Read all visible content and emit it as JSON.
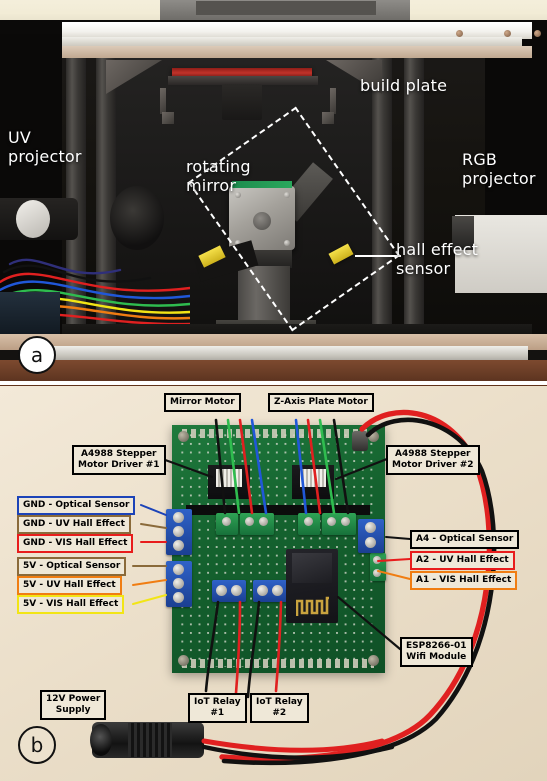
{
  "figure": {
    "panels": [
      {
        "id": "a",
        "badge": "a",
        "kind": "photograph",
        "caption_labels": [
          {
            "name": "uv-projector",
            "text": "UV\nprojector"
          },
          {
            "name": "rotating-mirror",
            "text": "rotating\nmirror"
          },
          {
            "name": "build-plate",
            "text": "build plate"
          },
          {
            "name": "rgb-projector",
            "text": "RGB\nprojector"
          },
          {
            "name": "hall-effect-sensor",
            "text": "hall effect\nsensor"
          }
        ]
      },
      {
        "id": "b",
        "badge": "b",
        "kind": "photograph",
        "callouts": [
          {
            "name": "mirror-motor",
            "text": "Mirror Motor",
            "border": "#000000"
          },
          {
            "name": "z-axis-plate-motor",
            "text": "Z-Axis Plate Motor",
            "border": "#000000"
          },
          {
            "name": "driver-1",
            "text": "A4988 Stepper\nMotor Driver #1",
            "border": "#000000"
          },
          {
            "name": "driver-2",
            "text": "A4988 Stepper\nMotor Driver #2",
            "border": "#000000"
          },
          {
            "name": "gnd-optical-sensor",
            "text": "GND - Optical Sensor",
            "border": "#1c43b8"
          },
          {
            "name": "gnd-uv-hall-effect",
            "text": "GND - UV Hall Effect",
            "border": "#8a6a3a"
          },
          {
            "name": "gnd-vis-hall-effect",
            "text": "GND - VIS Hall Effect",
            "border": "#e81c1c"
          },
          {
            "name": "5v-optical-sensor",
            "text": "5V - Optical Sensor",
            "border": "#8a6a3a"
          },
          {
            "name": "5v-uv-hall-effect",
            "text": "5V - UV Hall Effect",
            "border": "#f07d12"
          },
          {
            "name": "5v-vis-hall-effect",
            "text": "5V - VIS Hall Effect",
            "border": "#f2e516"
          },
          {
            "name": "a4-optical-sensor",
            "text": "A4 - Optical Sensor",
            "border": "#000000"
          },
          {
            "name": "a2-uv-hall-effect",
            "text": "A2 - UV Hall Effect",
            "border": "#e81c1c"
          },
          {
            "name": "a1-vis-hall-effect",
            "text": "A1 - VIS Hall Effect",
            "border": "#f07d12"
          },
          {
            "name": "esp8266-wifi-module",
            "text": "ESP8266-01\nWifi Module",
            "border": "#000000"
          },
          {
            "name": "iot-relay-1",
            "text": "IoT Relay\n#1",
            "border": "#000000"
          },
          {
            "name": "iot-relay-2",
            "text": "IoT Relay\n#2",
            "border": "#000000"
          },
          {
            "name": "12v-power-supply",
            "text": "12V Power\nSupply",
            "border": "#000000"
          }
        ]
      }
    ],
    "colors": {
      "wire_red": "#e02020",
      "wire_black": "#111111",
      "wire_green": "#2fbc4f",
      "wire_blue": "#2057d8",
      "wire_orange": "#f07d12",
      "wire_yellow": "#f2e516",
      "wire_brown": "#8a6a3a",
      "pcb_green": "#17713a",
      "terminal_blue": "#2f62c8",
      "terminal_green": "#2fa355",
      "panel_b_background": "#ece0cb",
      "label_fill": "#efe8d8"
    }
  }
}
